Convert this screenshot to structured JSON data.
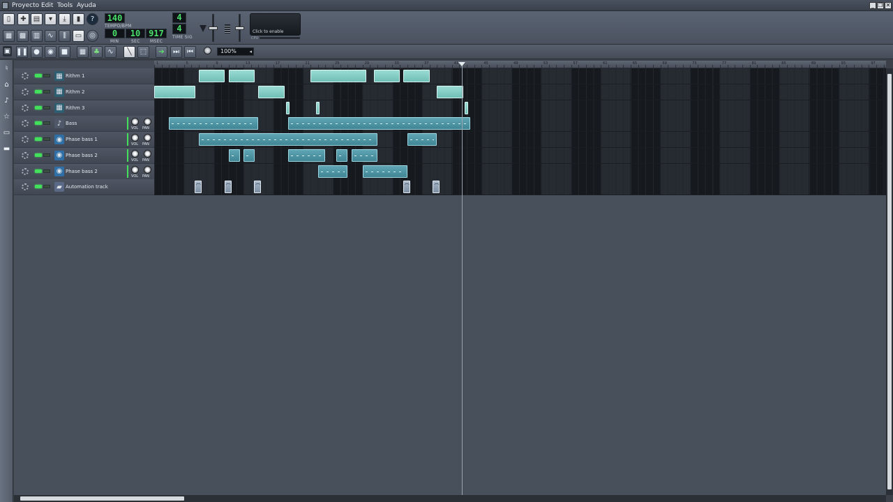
{
  "menu": {
    "items": [
      "Proyecto",
      "Edit",
      "Tools",
      "Ayuda"
    ]
  },
  "window_buttons": [
    "_",
    "❐",
    "✕"
  ],
  "transport": {
    "tempo": "140",
    "tempo_label": "TEMPO/BPM",
    "time_min": "0",
    "time_sec": "10",
    "time_msec": "917",
    "min_label": "MIN",
    "sec_label": "SEC",
    "msec_label": "MSEC",
    "timesig_num": "4",
    "timesig_den": "4",
    "timesig_label": "TIME SIG"
  },
  "cpu": {
    "text": "Click to enable",
    "label": "CPU"
  },
  "zoom": {
    "value": "100%"
  },
  "ruler": {
    "numbers": [
      "1",
      "5",
      "9",
      "13",
      "17",
      "21",
      "25",
      "29",
      "33",
      "37",
      "41",
      "45",
      "49",
      "53",
      "57",
      "61",
      "65",
      "69",
      "73",
      "77",
      "81",
      "85",
      "89",
      "93",
      "97"
    ]
  },
  "tracks": [
    {
      "name": "Rithm 1",
      "icon": "beat-icon",
      "type": "beat"
    },
    {
      "name": "Rithm 2",
      "icon": "beat-icon",
      "type": "beat"
    },
    {
      "name": "Rithm 3",
      "icon": "beat-icon",
      "type": "beat"
    },
    {
      "name": "Bass",
      "icon": "note-icon",
      "type": "inst"
    },
    {
      "name": "Phase bass 1",
      "icon": "synth-icon",
      "type": "inst"
    },
    {
      "name": "Phase bass 2",
      "icon": "synth-icon",
      "type": "inst"
    },
    {
      "name": "Phase bass 2",
      "icon": "synth-icon",
      "type": "inst"
    },
    {
      "name": "Automation track",
      "icon": "folder-icon",
      "type": "auto"
    }
  ],
  "knob_labels": {
    "vol": "VOL",
    "pan": "PAN"
  },
  "clips_bars": [
    [
      [
        7,
        10.5
      ],
      [
        11,
        14.5
      ],
      [
        22,
        29.5
      ],
      [
        30.5,
        34
      ],
      [
        34.5,
        38
      ]
    ],
    [
      [
        1,
        6.5
      ],
      [
        15,
        18.5
      ],
      [
        39,
        42.5
      ]
    ],
    [
      [
        18.7,
        19.2
      ],
      [
        22.7,
        23.2
      ],
      [
        42.7,
        43.2
      ]
    ],
    [
      [
        3,
        15
      ],
      [
        19,
        43.5
      ]
    ],
    [
      [
        7,
        31
      ],
      [
        35,
        39
      ]
    ],
    [
      [
        11,
        12.5
      ],
      [
        13,
        14.5
      ],
      [
        19,
        24
      ],
      [
        25.5,
        27
      ],
      [
        27.5,
        31
      ]
    ],
    [
      [
        23,
        27
      ],
      [
        29,
        35
      ]
    ],
    [
      [
        6.8,
        7.2
      ],
      [
        10.8,
        11.2
      ],
      [
        14.8,
        15.2
      ],
      [
        34.8,
        35.2
      ],
      [
        38.8,
        39.2
      ]
    ]
  ],
  "colors": {
    "beat_clip": "#8fd4cc",
    "inst_clip": "#4f97a6",
    "mute_led": "#43e05b",
    "lcd_text": "#49e06a"
  }
}
